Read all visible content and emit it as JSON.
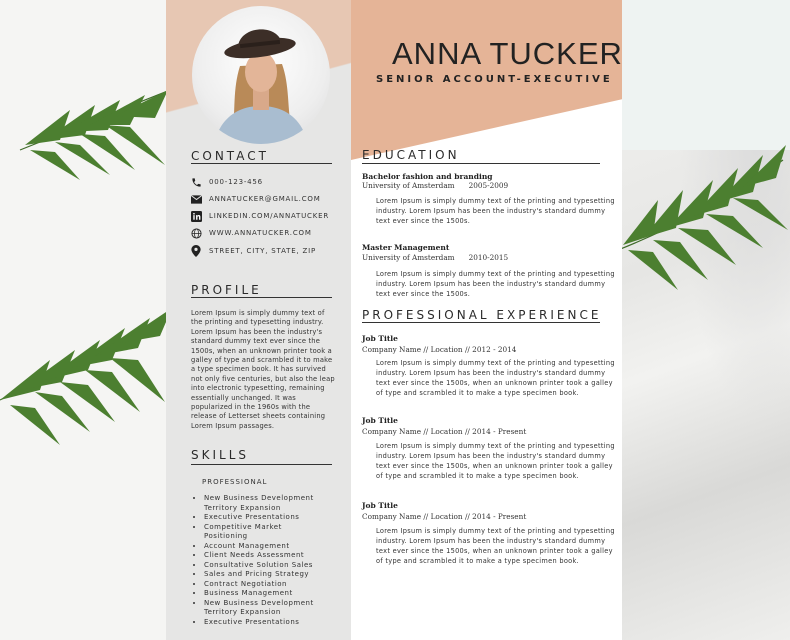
{
  "name": "ANNA TUCKER",
  "title": "SENIOR ACCOUNT-EXECUTIVE",
  "contact": {
    "heading": "CONTACT",
    "items": [
      {
        "icon": "phone-icon",
        "text": "000-123-456"
      },
      {
        "icon": "email-icon",
        "text": "ANNATUCKER@GMAIL.COM"
      },
      {
        "icon": "linkedin-icon",
        "text": "LINKEDIN.COM/ANNATUCKER"
      },
      {
        "icon": "globe-icon",
        "text": "WWW.ANNATUCKER.COM"
      },
      {
        "icon": "location-pin-icon",
        "text": "STREET, CITY, STATE, ZIP"
      }
    ]
  },
  "profile": {
    "heading": "PROFILE",
    "text": "Lorem Ipsum is simply dummy text of the printing and typesetting industry. Lorem Ipsum has been the industry's standard dummy text ever since the 1500s, when an unknown printer took a galley of type and scrambled it to make a type specimen book. It has survived not only five centuries, but also the leap into electronic typesetting, remaining essentially unchanged. It was popularized in the 1960s with the release of Letterset sheets containing Lorem Ipsum passages."
  },
  "skills": {
    "heading": "SKILLS",
    "subheading": "PROFESSIONAL",
    "items": [
      "New Business Development",
      "Territory Expansion",
      "Executive Presentations",
      "Competitive Market Positioning",
      "Account Management",
      "Client Needs Assessment",
      "Consultative Solution Sales",
      "Sales and Pricing Strategy",
      "Contract Negotiation",
      "Business Management",
      "New Business Development",
      "Territory Expansion",
      "Executive Presentations"
    ]
  },
  "education": {
    "heading": "EDUCATION",
    "entries": [
      {
        "degree": "Bachelor fashion and branding",
        "school": "University of Amsterdam",
        "years": "2005-2009",
        "desc": "Lorem Ipsum is simply dummy text of the printing and typesetting industry. Lorem Ipsum has been the industry's standard dummy text ever since the 1500s."
      },
      {
        "degree": "Master Management",
        "school": "University of Amsterdam",
        "years": "2010-2015",
        "desc": "Lorem Ipsum is simply dummy text of the printing and typesetting industry. Lorem Ipsum has been the industry's standard dummy text ever since the 1500s."
      }
    ]
  },
  "experience": {
    "heading": "PROFESSIONAL EXPERIENCE",
    "entries": [
      {
        "title": "Job Title",
        "sub": "Company Name // Location // 2012 - 2014",
        "desc": "Lorem Ipsum is simply dummy text of the printing and typesetting industry. Lorem Ipsum has been the industry's standard dummy text ever since the 1500s, when an unknown printer took a galley of type and scrambled it to make a type specimen book."
      },
      {
        "title": "Job Title",
        "sub": "Company Name // Location // 2014 - Present",
        "desc": "Lorem Ipsum is simply dummy text of the printing and typesetting industry. Lorem Ipsum has been the industry's standard dummy text ever since the 1500s, when an unknown printer took a galley of type and scrambled it to make a type specimen book."
      },
      {
        "title": "Job Title",
        "sub": "Company Name // Location // 2014 - Present",
        "desc": "Lorem Ipsum is simply dummy text of the printing and typesetting industry. Lorem Ipsum has been the industry's standard dummy text ever since the 1500s, when an unknown printer took a galley of type and scrambled it to make a type specimen book."
      }
    ]
  },
  "colors": {
    "accent": "#e5b497",
    "sidebar": "#e6e6e5",
    "text": "#222222"
  }
}
